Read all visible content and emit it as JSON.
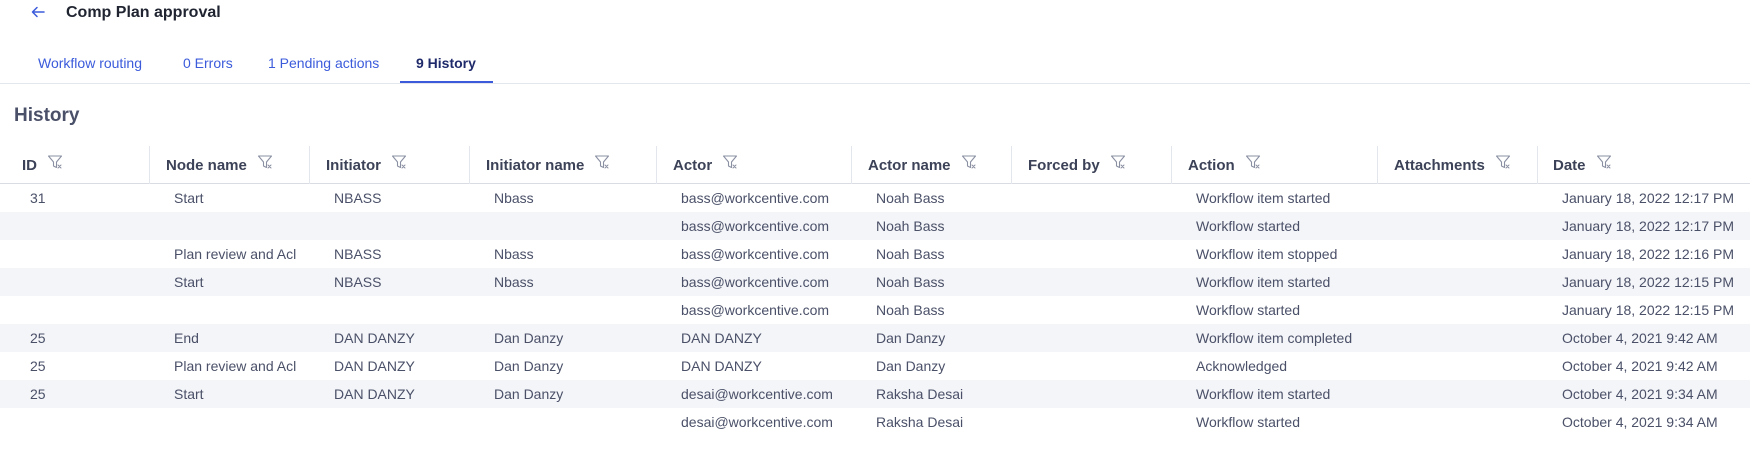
{
  "header": {
    "title": "Comp Plan approval",
    "back_icon": "arrow-left-icon"
  },
  "tabs": [
    {
      "label": "Workflow routing",
      "active": false
    },
    {
      "label": "0 Errors",
      "active": false
    },
    {
      "label": "1 Pending actions",
      "active": false
    },
    {
      "label": "9 History",
      "active": true
    }
  ],
  "section": {
    "title": "History"
  },
  "colors": {
    "accent": "#3b5bdb",
    "active_tab": "#1f2a6b",
    "row_alt": "#f4f5f8"
  },
  "table": {
    "columns": [
      "ID",
      "Node name",
      "Initiator",
      "Initiator name",
      "Actor",
      "Actor name",
      "Forced by",
      "Action",
      "Attachments",
      "Date"
    ],
    "filter_icon": "filter-icon",
    "rows": [
      [
        "31",
        "Start",
        "NBASS",
        "Nbass",
        "bass@workcentive.com",
        "Noah Bass",
        "",
        "Workflow item started",
        "",
        "January 18, 2022 12:17 PM"
      ],
      [
        "",
        "",
        "",
        "",
        "bass@workcentive.com",
        "Noah Bass",
        "",
        "Workflow started",
        "",
        "January 18, 2022 12:17 PM"
      ],
      [
        "",
        "Plan  review and Acl",
        "NBASS",
        "Nbass",
        "bass@workcentive.com",
        "Noah Bass",
        "",
        "Workflow item stopped",
        "",
        "January 18, 2022 12:16 PM"
      ],
      [
        "",
        "Start",
        "NBASS",
        "Nbass",
        "bass@workcentive.com",
        "Noah Bass",
        "",
        "Workflow item started",
        "",
        "January 18, 2022 12:15 PM"
      ],
      [
        "",
        "",
        "",
        "",
        "bass@workcentive.com",
        "Noah Bass",
        "",
        "Workflow started",
        "",
        "January 18, 2022 12:15 PM"
      ],
      [
        "25",
        "End",
        "DAN DANZY",
        "Dan Danzy",
        "DAN DANZY",
        "Dan Danzy",
        "",
        "Workflow item completed",
        "",
        "October 4, 2021 9:42 AM"
      ],
      [
        "25",
        "Plan  review and Acl",
        "DAN DANZY",
        "Dan Danzy",
        "DAN DANZY",
        "Dan Danzy",
        "",
        "Acknowledged",
        "",
        "October 4, 2021 9:42 AM"
      ],
      [
        "25",
        "Start",
        "DAN DANZY",
        "Dan Danzy",
        "desai@workcentive.com",
        "Raksha Desai",
        "",
        "Workflow item started",
        "",
        "October 4, 2021 9:34 AM"
      ],
      [
        "",
        "",
        "",
        "",
        "desai@workcentive.com",
        "Raksha Desai",
        "",
        "Workflow started",
        "",
        "October 4, 2021 9:34 AM"
      ]
    ]
  }
}
